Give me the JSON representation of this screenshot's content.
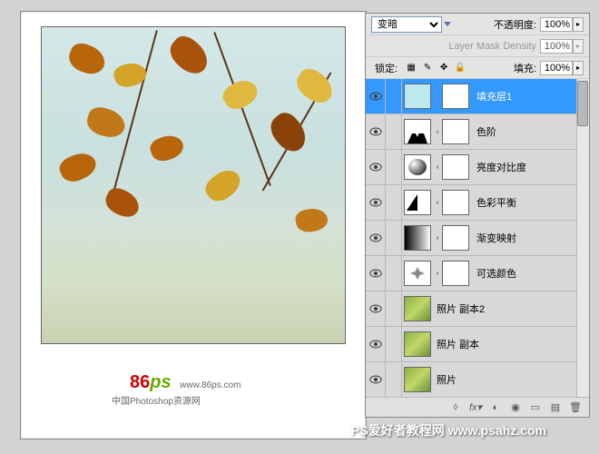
{
  "blend_mode": "变暗",
  "opacity_label": "不透明度:",
  "opacity_value": "100%",
  "mask_density_label": "Layer Mask Density",
  "mask_density_value": "100%",
  "lock_label": "锁定:",
  "fill_label": "填充:",
  "fill_value": "100%",
  "layers": [
    {
      "name": "填充层1",
      "type": "fill",
      "selected": true,
      "has_mask": true
    },
    {
      "name": "色阶",
      "type": "levels",
      "has_mask": true
    },
    {
      "name": "亮度对比度",
      "type": "bc",
      "has_mask": true
    },
    {
      "name": "色彩平衡",
      "type": "cbal",
      "has_mask": true
    },
    {
      "name": "渐变映射",
      "type": "gmap",
      "has_mask": true
    },
    {
      "name": "可选颜色",
      "type": "selcol",
      "has_mask": true
    },
    {
      "name": "照片 副本2",
      "type": "photo",
      "has_mask": false
    },
    {
      "name": "照片 副本",
      "type": "photo",
      "has_mask": false
    },
    {
      "name": "照片",
      "type": "photo",
      "has_mask": false
    }
  ],
  "logo_main": "86ps",
  "logo_url": "www.86ps.com",
  "logo_sub": "中国Photoshop资源网",
  "watermark": "PS爱好者教程网 www.psahz.com",
  "footer_icons": [
    "link",
    "fx",
    "mask",
    "adjust",
    "folder",
    "new",
    "trash"
  ]
}
